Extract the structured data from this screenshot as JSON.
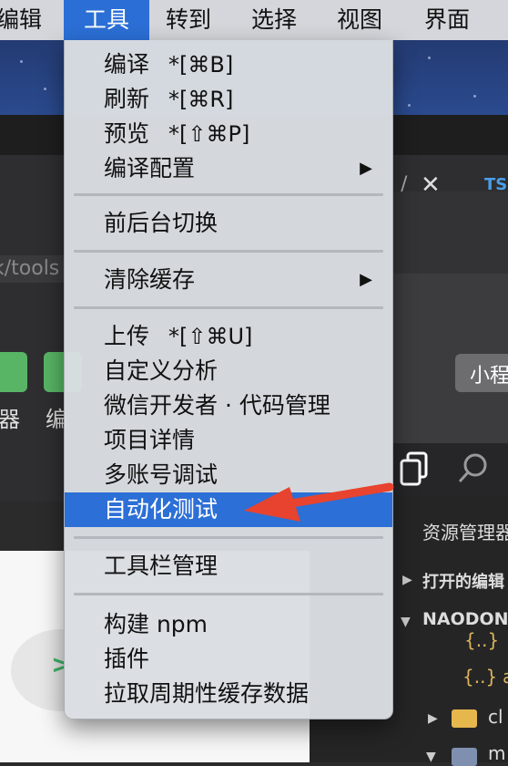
{
  "menubar": {
    "items": [
      "编辑",
      "工具",
      "转到",
      "选择",
      "视图",
      "界面"
    ],
    "active": "工具"
  },
  "tools_menu": {
    "items": [
      {
        "label": "编译",
        "shortcut": "*[⌘B]"
      },
      {
        "label": "刷新",
        "shortcut": "*[⌘R]"
      },
      {
        "label": "预览",
        "shortcut": "*[⇧⌘P]"
      },
      {
        "label": "编译配置",
        "submenu": "▶"
      },
      {
        "label": "前后台切换"
      },
      {
        "label": "清除缓存",
        "submenu": "▶"
      },
      {
        "label": "上传",
        "shortcut": "*[⇧⌘U]"
      },
      {
        "label": "自定义分析"
      },
      {
        "label": "微信开发者 · 代码管理"
      },
      {
        "label": "项目详情"
      },
      {
        "label": "多账号调试"
      },
      {
        "label": "自动化测试",
        "highlighted": true
      },
      {
        "label": "工具栏管理"
      },
      {
        "label": "构建 npm"
      },
      {
        "label": "插件"
      },
      {
        "label": "拉取周期性缓存数据"
      }
    ]
  },
  "background": {
    "left_path_fragment": "k/tools",
    "left_labels": [
      "器",
      "编"
    ],
    "tab_ts": "TS",
    "mini_program_button": "小程",
    "explorer": {
      "title": "资源管理器",
      "open_editors": "打开的编辑",
      "project": "NAODON",
      "folder_cl": "cl",
      "folder_m": "m",
      "file_a": "a"
    }
  },
  "colors": {
    "highlight": "#2c6fd6",
    "arrow": "#e8432e",
    "menubar_active": "#2b6fd6"
  }
}
